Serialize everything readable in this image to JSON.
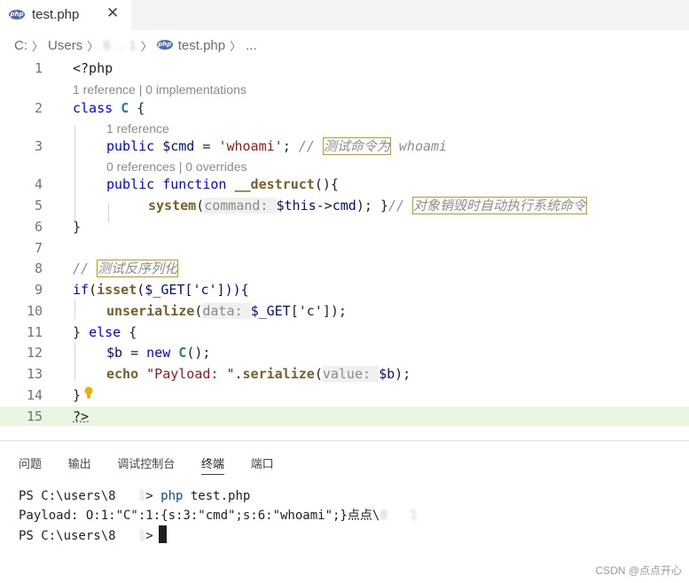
{
  "tab": {
    "title": "test.php",
    "close": "✕",
    "badge": "php"
  },
  "breadcrumb": {
    "drive": "C:",
    "users": "Users",
    "user": "8 ... 1",
    "badge": "php",
    "file": "test.php",
    "more": "..."
  },
  "editor": {
    "lines": [
      {
        "num": "1"
      },
      {
        "num": "2"
      },
      {
        "num": "3"
      },
      {
        "num": "4"
      },
      {
        "num": "5"
      },
      {
        "num": "6"
      },
      {
        "num": "7"
      },
      {
        "num": "8"
      },
      {
        "num": "9"
      },
      {
        "num": "10"
      },
      {
        "num": "11"
      },
      {
        "num": "12"
      },
      {
        "num": "13"
      },
      {
        "num": "14"
      },
      {
        "num": "15"
      }
    ],
    "code": {
      "l1": "<?php",
      "lens1": "1 reference | 0 implementations",
      "l2_kw": "class",
      "l2_cls": "C",
      "l2_brace": " {",
      "lens2": "1 reference",
      "l3_kw": "public",
      "l3_var": " $cmd",
      "l3_eq": " = ",
      "l3_str": "'whoami'",
      "l3_semi": "; ",
      "l3_cm_slash": "// ",
      "l3_cm_box": "测试命令为",
      "l3_cm_rest": " whoami",
      "lens3": "0 references | 0 overrides",
      "l4_kw": "public",
      "l4_kw2": " function",
      "l4_fn": " __destruct",
      "l4_rest": "(){",
      "l5_fn": "system",
      "l5_open": "(",
      "l5_hint": "command: ",
      "l5_var": "$this",
      "l5_arrow": "->",
      "l5_prop": "cmd",
      "l5_close": "); }",
      "l5_cm_slash": "// ",
      "l5_cm_box": "对象销毁时自动执行系统命令",
      "l6": "}",
      "l8_cm_slash": "// ",
      "l8_cm_box": "测试反序列化",
      "l9_kw": "if",
      "l9_open": "(",
      "l9_fn": "isset",
      "l9_rest": "($_GET['c'])){",
      "l10_fn": "unserialize",
      "l10_open": "(",
      "l10_hint": "data: ",
      "l10_var": "$_GET",
      "l10_rest": "['c']);",
      "l11_brace": "} ",
      "l11_kw": "else",
      "l11_rest": " {",
      "l12_var": "$b",
      "l12_eq": " = ",
      "l12_kw": "new",
      "l12_cls": " C",
      "l12_rest": "();",
      "l13_fn": "echo",
      "l13_str": " \"Payload: \"",
      "l13_dot": ".",
      "l13_fn2": "serialize",
      "l13_open": "(",
      "l13_hint": "value: ",
      "l13_var": "$b",
      "l13_rest": ");",
      "l14": "}",
      "l15": "?>"
    }
  },
  "panel": {
    "tabs": [
      "问题",
      "输出",
      "调试控制台",
      "终端",
      "端口"
    ],
    "active_tab": "终端"
  },
  "terminal": {
    "line1_prompt": "PS C:\\users\\8",
    "line1_blur": "   1",
    "line1_gt": "> ",
    "line1_cmd": "php",
    "line1_arg": " test.php",
    "line2_text": "Payload: O:1:\"C\":1:{s:3:\"cmd\";s:6:\"whoami\";}点点\\",
    "line2_blur": "8   1",
    "line3_prompt": "PS C:\\users\\8",
    "line3_blur": "   1",
    "line3_gt": ">"
  },
  "watermark": "CSDN @点点开心",
  "colors": {
    "keyword": "#0000ff",
    "string": "#a31515",
    "function": "#795e26",
    "variable": "#001080",
    "comment_box": "#d19a00",
    "line15_highlight": "#e8f5e0"
  }
}
